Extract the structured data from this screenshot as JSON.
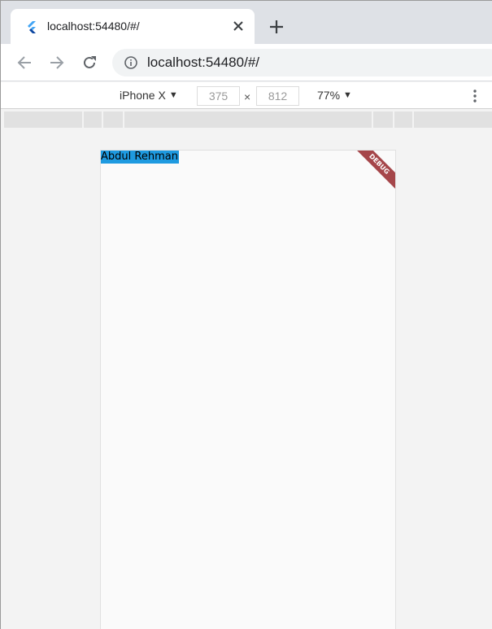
{
  "browser": {
    "tab_title": "localhost:54480/#/",
    "url": "localhost:54480/#/"
  },
  "device_toolbar": {
    "device": "iPhone X",
    "width": "375",
    "height": "812",
    "zoom": "77%"
  },
  "app": {
    "text": "Abdul Rehman",
    "debug_label": "DEBUG"
  },
  "colors": {
    "accent": "#1e9ae0",
    "debug_banner": "#a5464a"
  }
}
